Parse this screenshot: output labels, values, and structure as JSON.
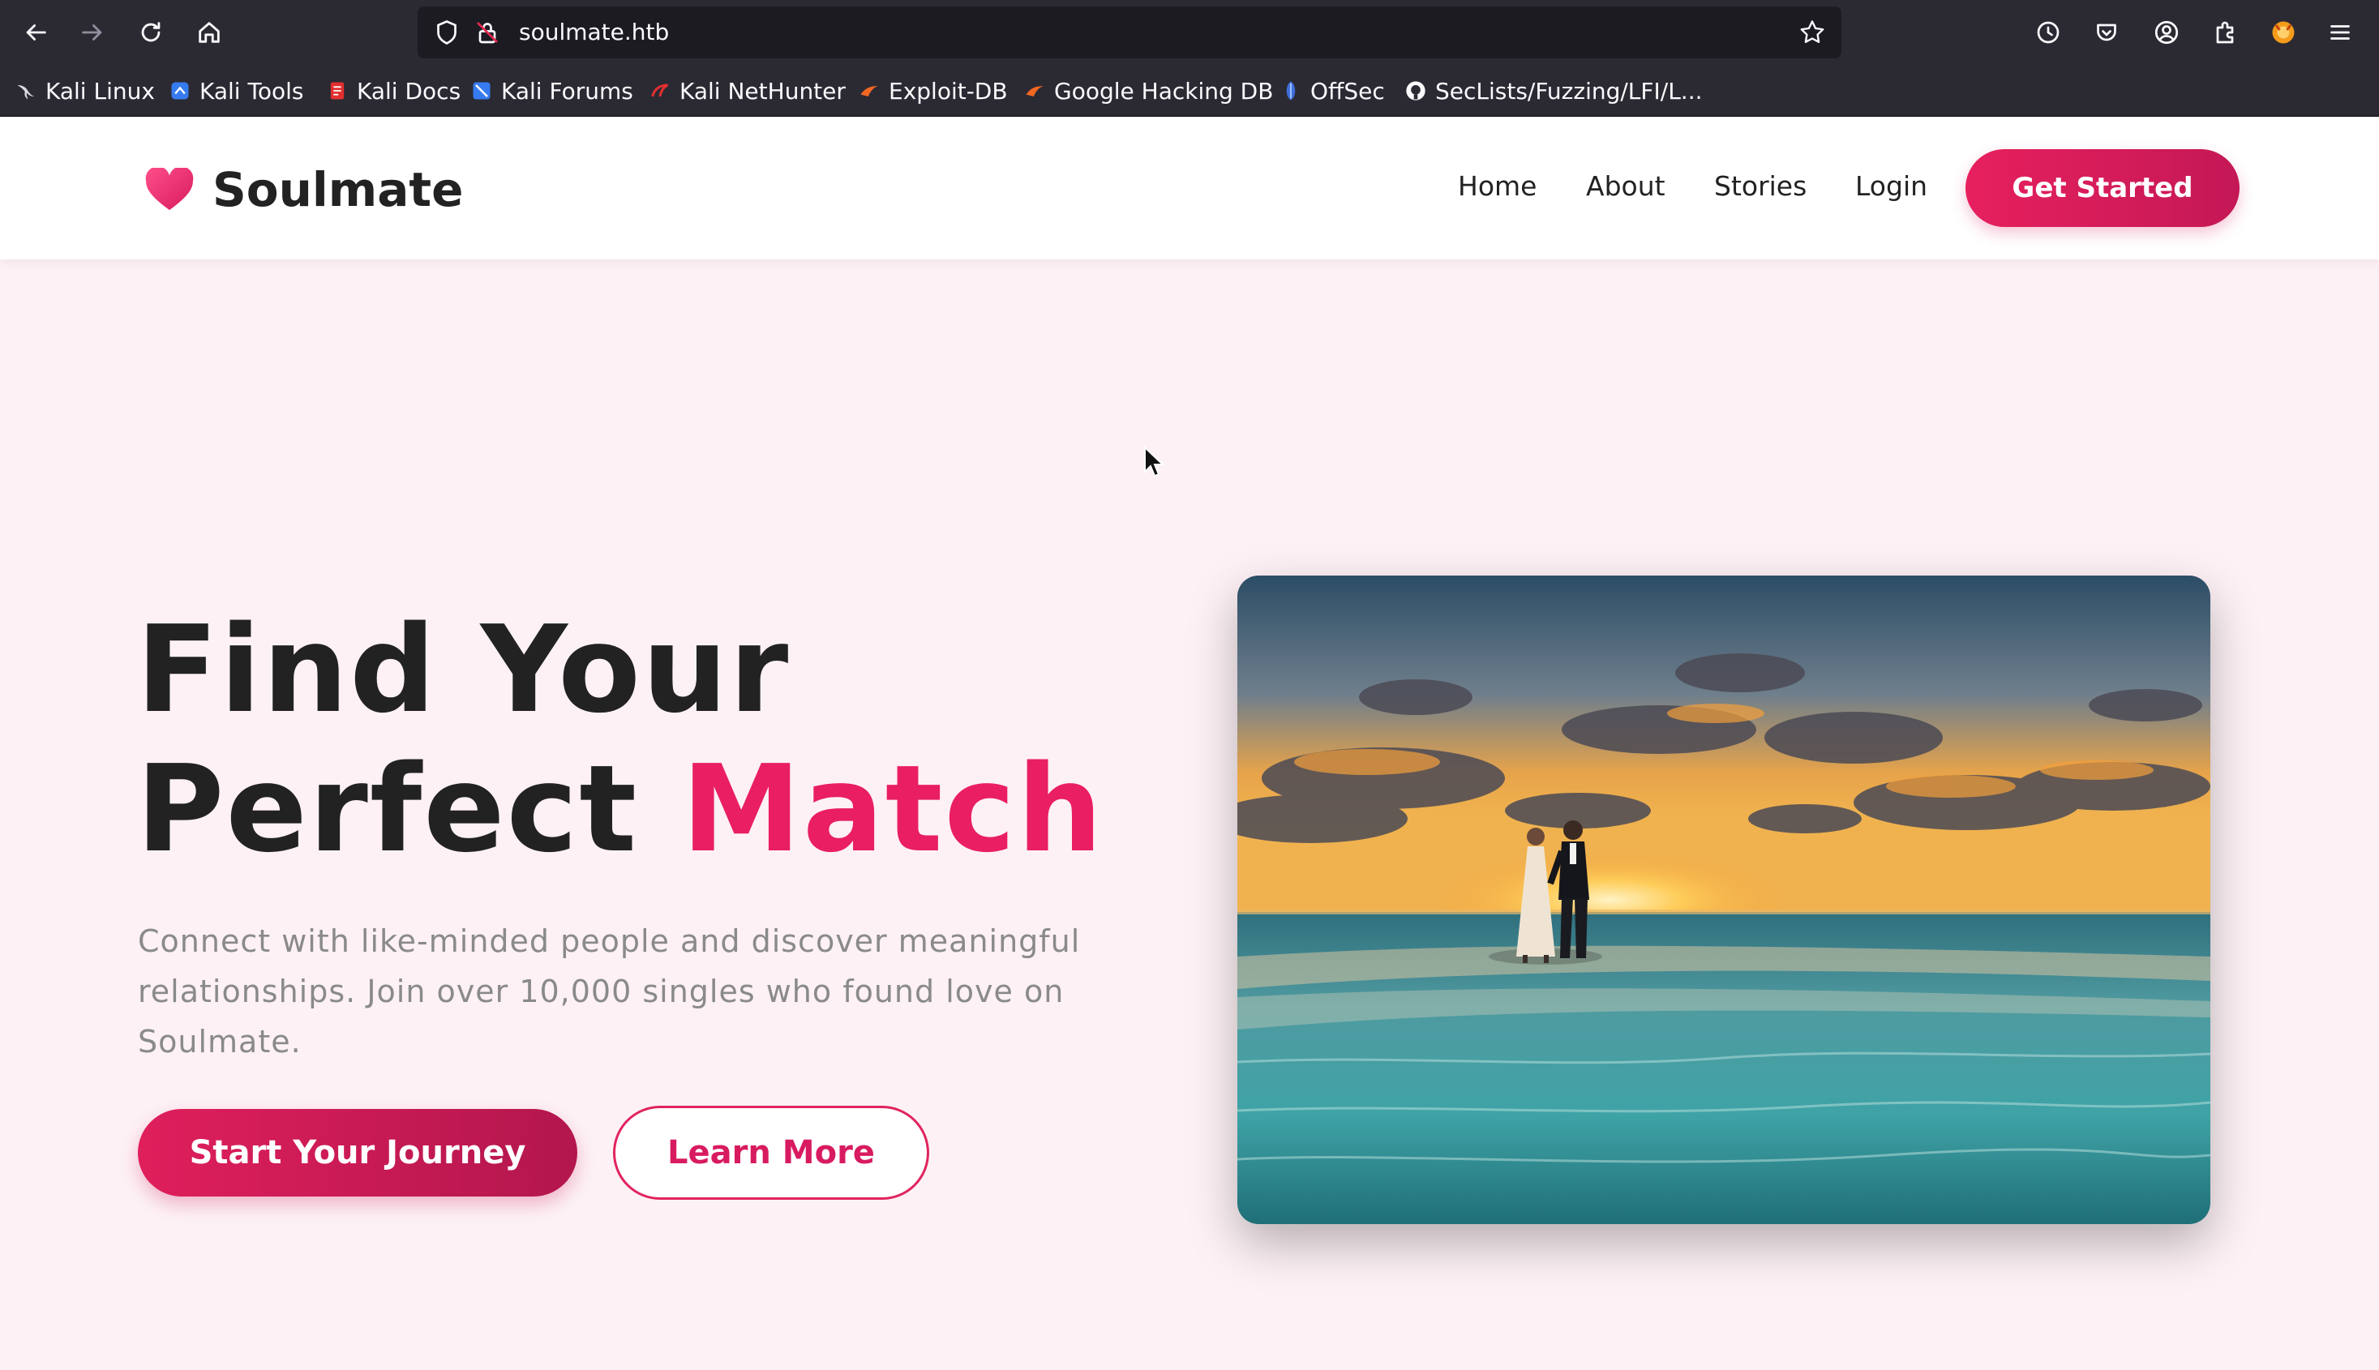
{
  "browser": {
    "url": "soulmate.htb",
    "bookmarks": [
      {
        "label": "Kali Linux",
        "icon": "kali-dragon-icon"
      },
      {
        "label": "Kali Tools",
        "icon": "kali-tools-icon"
      },
      {
        "label": "Kali Docs",
        "icon": "kali-docs-icon"
      },
      {
        "label": "Kali Forums",
        "icon": "kali-forums-icon"
      },
      {
        "label": "Kali NetHunter",
        "icon": "kali-nethunter-icon"
      },
      {
        "label": "Exploit-DB",
        "icon": "exploit-db-icon"
      },
      {
        "label": "Google Hacking DB",
        "icon": "ghdb-icon"
      },
      {
        "label": "OffSec",
        "icon": "offsec-icon"
      },
      {
        "label": "SecLists/Fuzzing/LFI/L...",
        "icon": "github-icon"
      }
    ]
  },
  "header": {
    "brand": "Soulmate",
    "nav": [
      "Home",
      "About",
      "Stories",
      "Login"
    ],
    "cta": "Get Started"
  },
  "hero": {
    "title_line1": "Find Your",
    "title_line2_prefix": "Perfect ",
    "title_accent": "Match",
    "subtitle": "Connect with like-minded people and discover meaningful relationships. Join over 10,000 singles who found love on Soulmate.",
    "primary_button": "Start Your Journey",
    "secondary_button": "Learn More",
    "image_subject": "couple-walking-on-beach-at-sunset"
  },
  "colors": {
    "accent": "#e91e63",
    "page_bg": "#fdf1f5",
    "browser_chrome": "#2b2a33",
    "text_dark": "#222222",
    "text_muted": "#8a8a8a"
  }
}
